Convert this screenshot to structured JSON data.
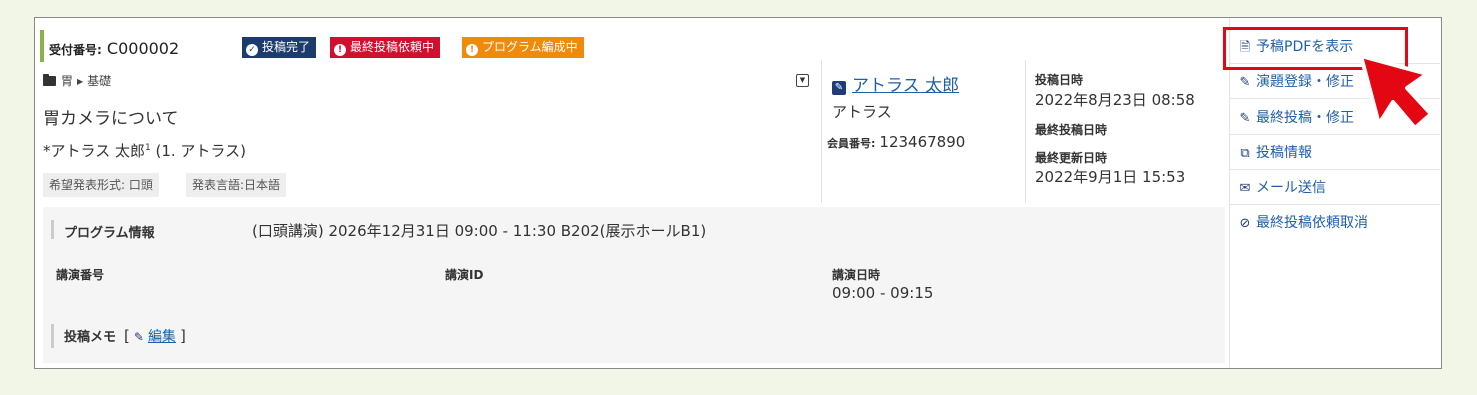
{
  "submission": {
    "reception_label": "受付番号:",
    "reception_number": "C000002",
    "badges": [
      {
        "label": "投稿完了",
        "icon": "check-circle-icon",
        "color": "#1d3c6e"
      },
      {
        "label": "最終投稿依頼中",
        "icon": "alert-circle-icon",
        "color": "#d10f2f"
      },
      {
        "label": "プログラム編成中",
        "icon": "alert-circle-icon",
        "color": "#f08a0b"
      }
    ],
    "breadcrumb": [
      "胃",
      "基礎"
    ],
    "title": "胃カメラについて",
    "authors": "*アトラス 太郎",
    "author_sup": "1",
    "author_aff": " (1. アトラス)",
    "tags": [
      "希望発表形式: 口頭",
      "発表言語:日本語"
    ]
  },
  "author": {
    "name": "アトラス 太郎",
    "affiliation": "アトラス",
    "member_label": "会員番号:",
    "member_number": "123467890"
  },
  "dates": {
    "posted_label": "投稿日時",
    "posted_value": "2022年8月23日 08:58",
    "final_label": "最終投稿日時",
    "updated_label": "最終更新日時",
    "updated_value": "2022年9月1日 15:53"
  },
  "program": {
    "label": "プログラム情報",
    "value": "(口頭講演) 2026年12月31日 09:00 - 11:30 B202(展示ホールB1)",
    "col1": "講演番号",
    "col2": "講演ID",
    "col3": "講演日時",
    "col3_value": "09:00 - 09:15",
    "memo_label": "投稿メモ",
    "memo_open": "[",
    "memo_close": "]",
    "memo_edit": "編集"
  },
  "sidebar": {
    "items": [
      {
        "label": "予稿PDFを表示",
        "icon": "pdf-file-icon"
      },
      {
        "label": "演題登録・修正",
        "icon": "pencil-icon"
      },
      {
        "label": "最終投稿・修正",
        "icon": "pencil-icon"
      },
      {
        "label": "投稿情報",
        "icon": "copy-icon"
      },
      {
        "label": "メール送信",
        "icon": "envelope-icon"
      },
      {
        "label": "最終投稿依頼取消",
        "icon": "ban-icon"
      }
    ]
  },
  "colors": {
    "accent": "#1f5fa8",
    "highlight": "#e30613",
    "page_bg": "#f1f6e6"
  }
}
